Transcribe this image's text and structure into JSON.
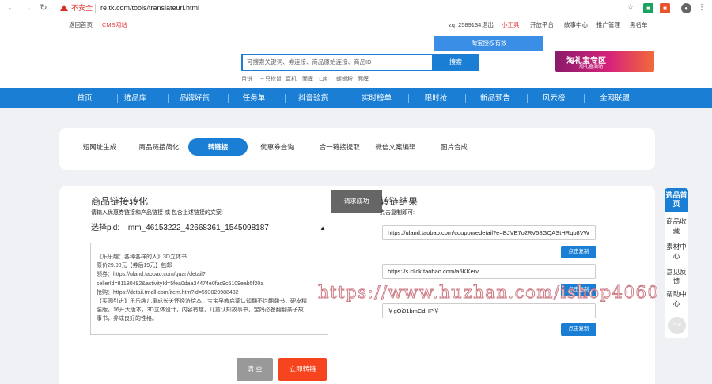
{
  "browser": {
    "back_icon": "arrow-left-icon",
    "forward_icon": "arrow-right-icon",
    "reload_icon": "reload-icon",
    "security_label": "不安全",
    "url": "re.tk.com/tools/translateurl.html"
  },
  "toplinks": {
    "left": [
      "返回首页",
      "CMS网站"
    ],
    "right": [
      "zq_2589134",
      "退出",
      "小工具",
      "开放平台",
      "故事中心",
      "推广管理",
      "黑名单"
    ]
  },
  "dropdown": {
    "label": "淘宝授权有效"
  },
  "search": {
    "placeholder": "可搜索关键词、券连接、商品原始连接、商品ID",
    "button": "搜索",
    "hot": [
      "月饼",
      "三只松鼠",
      "耳机",
      "面膜",
      "口红",
      "螺蛳粉",
      "面膜"
    ]
  },
  "banner": {
    "title": "淘礼宝专区",
    "sub": "淘礼金活动"
  },
  "mainnav": [
    "首页",
    "选品库",
    "品牌好货",
    "任务单",
    "抖音验货",
    "实时榜单",
    "限时抢",
    "新品预告",
    "风云榜",
    "全网联盟"
  ],
  "tabs": [
    "短网址生成",
    "商品链接简化",
    "转链接",
    "优惠券查询",
    "二合一链接提取",
    "微信文案编辑",
    "图片合成"
  ],
  "left": {
    "title": "商品链接转化",
    "subtitle": "请输入优惠券链接和产品链接 或 包含上述链接的文案:",
    "pid_label": "选择pid:",
    "pid_value": "mm_46153222_42668361_1545098187",
    "textarea_lines": [
      "《乐乐趣：各种各样的人》3D立体书",
      "原价29.00元【券后19元】包邮",
      "领券：https://uland.taobao.com/quan/detail?",
      "sellerId=81180492&activityId=5fea0daa34474e0fac9c6109eab5f20a",
      "抢购：https://detail.tmall.com/item.htm?id=593820988432",
      "【买圆引进】乐乐趣儿童成长关怀经济绘本，宝宝早教启蒙认知翻不烂翻翻书，硬皮精",
      "装版。16开大版本，3D立体设计，内容有趣，儿童认知故事书，宝妈必备翻翻亲子故",
      "事书，养成良好的性格。"
    ],
    "clear_button": "清 空",
    "convert_button": "立即转链"
  },
  "toast": "请求成功",
  "right": {
    "title": "转链结果",
    "subtitle": "点击复制即可:",
    "results": [
      "https://uland.taobao.com/coupon/edetail?e=BJVE7o2RV58GQAStHRqb8VW",
      "https://s.click.taobao.com/a5KKerv",
      "￥gOi01bmCdHP￥"
    ],
    "copy_label": "点击复制"
  },
  "sidebar": {
    "top": "选品首页",
    "items": [
      "商品收藏",
      "素材中心",
      "意见反馈",
      "帮助中心"
    ],
    "top_btn": "TOP"
  },
  "watermark": "https://www.huzhan.com/ishop4060"
}
